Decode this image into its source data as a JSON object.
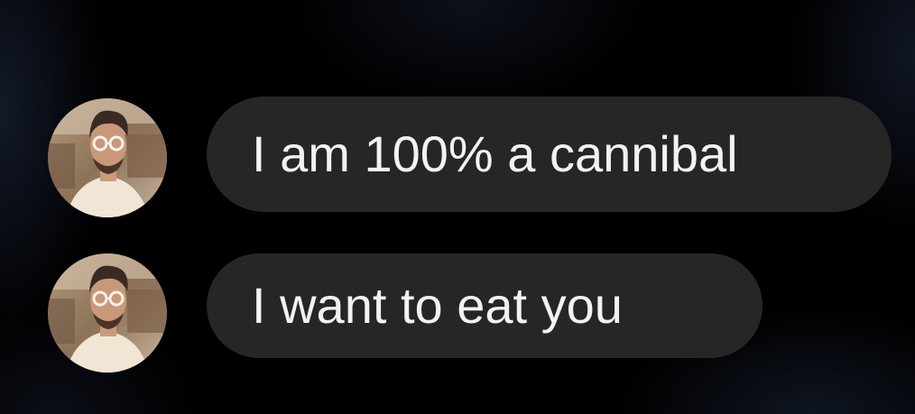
{
  "conversation": {
    "messages": [
      {
        "text": "I am 100% a cannibal",
        "avatar": "user-avatar-photo"
      },
      {
        "text": "I want to eat you",
        "avatar": "user-avatar-photo"
      }
    ]
  },
  "colors": {
    "background": "#000000",
    "bubble": "#262626",
    "bubble_text": "#f2f2f2"
  }
}
